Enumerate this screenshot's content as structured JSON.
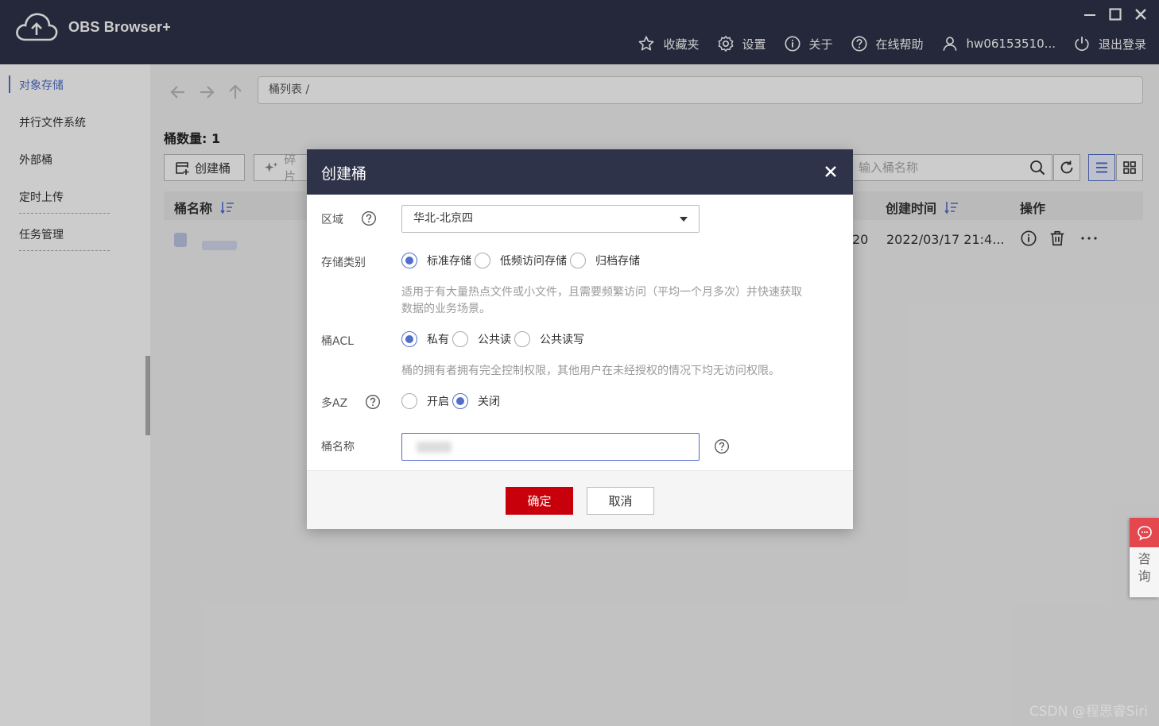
{
  "header": {
    "app_title": "OBS Browser+",
    "nav": [
      {
        "label": "收藏夹",
        "icon": "star-icon"
      },
      {
        "label": "设置",
        "icon": "gear-icon"
      },
      {
        "label": "关于",
        "icon": "info-icon"
      },
      {
        "label": "在线帮助",
        "icon": "help-icon"
      },
      {
        "label": "hw06153510...",
        "icon": "user-icon"
      },
      {
        "label": "退出登录",
        "icon": "power-icon"
      }
    ]
  },
  "sidebar": {
    "items": [
      {
        "label": "对象存储",
        "active": true
      },
      {
        "label": "并行文件系统",
        "active": false
      },
      {
        "label": "外部桶",
        "active": false
      },
      {
        "label": "定时上传",
        "active": false
      },
      {
        "label": "任务管理",
        "active": false
      }
    ]
  },
  "main": {
    "breadcrumb": "桶列表 /",
    "bucket_count_label": "桶数量:",
    "bucket_count_value": "1",
    "toolbar": {
      "create_bucket": "创建桶",
      "fragments": "碎片"
    },
    "search": {
      "placeholder": "输入桶名称"
    },
    "table": {
      "columns": [
        "桶名称",
        "创建时间",
        "操作"
      ],
      "rows": [
        {
          "partial_col": "20",
          "created": "2022/03/17 21:4..."
        }
      ]
    }
  },
  "dialog": {
    "title": "创建桶",
    "region": {
      "label": "区域",
      "value": "华北-北京四"
    },
    "storage_class": {
      "label": "存储类别",
      "options": [
        "标准存储",
        "低频访问存储",
        "归档存储"
      ],
      "selected": 0,
      "hint": "适用于有大量热点文件或小文件，且需要频繁访问（平均一个月多次）并快速获取数据的业务场景。",
      "hint_line1": "适用于有大量热点文件或小文件，且需要频繁访问（平均一个月多次）并快速获取",
      "hint_line2": "数据的业务场景。"
    },
    "acl": {
      "label": "桶ACL",
      "options": [
        "私有",
        "公共读",
        "公共读写"
      ],
      "selected": 0,
      "hint": "桶的拥有者拥有完全控制权限，其他用户在未经授权的情况下均无访问权限。"
    },
    "multi_az": {
      "label": "多AZ",
      "options": [
        "开启",
        "关闭"
      ],
      "selected": 1
    },
    "bucket_name": {
      "label": "桶名称"
    },
    "ok_label": "确定",
    "cancel_label": "取消"
  },
  "consult": {
    "label_1": "咨",
    "label_2": "询"
  },
  "watermark": "CSDN @程思睿Siri",
  "colors": {
    "header_bg": "#2e3349",
    "accent": "#526ecc",
    "primary_button": "#c7000b",
    "consult_red": "#e4474e"
  }
}
